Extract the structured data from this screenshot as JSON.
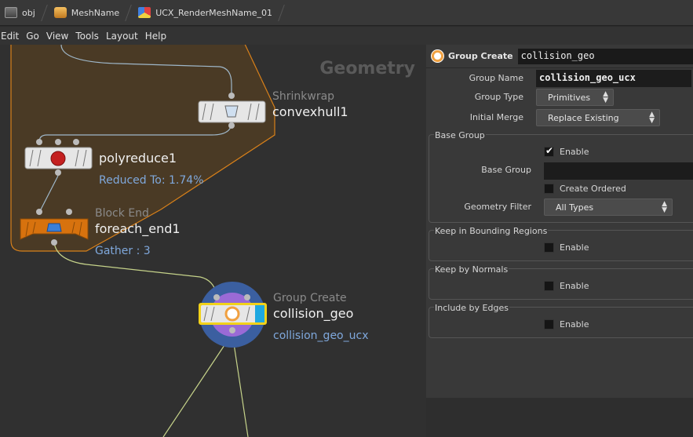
{
  "path": [
    {
      "label": "obj",
      "icon": "object-network-icon"
    },
    {
      "label": "MeshName",
      "icon": "geometry-object-icon"
    },
    {
      "label": "UCX_RenderMeshName_01",
      "icon": "sop-network-icon"
    }
  ],
  "menu": [
    "Edit",
    "Go",
    "View",
    "Tools",
    "Layout",
    "Help"
  ],
  "network": {
    "context_label": "Geometry",
    "nodes": [
      {
        "id": "convexhull",
        "type": "Shrinkwrap",
        "name": "convexhull1",
        "info": ""
      },
      {
        "id": "polyreduce",
        "type": "",
        "name": "polyreduce1",
        "info": "Reduced To: 1.74%"
      },
      {
        "id": "foreach_end",
        "type": "Block End",
        "name": "foreach_end1",
        "info": "Gather : 3"
      },
      {
        "id": "collision",
        "type": "Group Create",
        "name": "collision_geo",
        "info": "collision_geo_ucx"
      }
    ]
  },
  "params": {
    "node_type": "Group Create",
    "node_name": "collision_geo",
    "group_name_label": "Group Name",
    "group_name_value": "collision_geo_ucx",
    "group_type_label": "Group Type",
    "group_type_value": "Primitives",
    "initial_merge_label": "Initial Merge",
    "initial_merge_value": "Replace Existing",
    "base_group": {
      "title": "Base Group",
      "enable_label": "Enable",
      "enable_checked": true,
      "base_group_label": "Base Group",
      "base_group_value": "",
      "create_ordered_label": "Create Ordered",
      "geometry_filter_label": "Geometry Filter",
      "geometry_filter_value": "All Types"
    },
    "keep_bounding": {
      "title": "Keep in Bounding Regions",
      "enable_label": "Enable"
    },
    "keep_normals": {
      "title": "Keep by Normals",
      "enable_label": "Enable"
    },
    "include_edges": {
      "title": "Include by Edges",
      "enable_label": "Enable"
    }
  },
  "colors": {
    "network_box": "#4a3a25",
    "network_box_border": "#d8801a",
    "wire": "#9fb7c9",
    "wire_green": "#c6d38a",
    "info_text": "#7fa8dc",
    "selected_outline": "#f2d21a"
  }
}
